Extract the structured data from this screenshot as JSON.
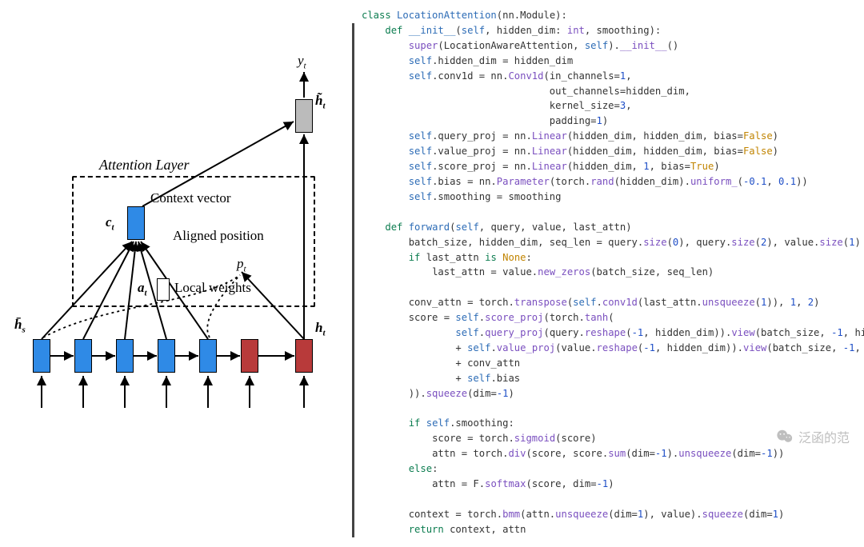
{
  "diagram": {
    "title": "Attention Layer",
    "context_vector_label": "Context vector",
    "aligned_position_label": "Aligned position",
    "local_weights_label": "Local weights",
    "y_t": "y",
    "y_t_sub": "t",
    "h_tilde": "h̃",
    "h_tilde_sub": "t",
    "c_t": "c",
    "c_t_sub": "t",
    "a_t": "a",
    "a_t_sub": "t",
    "p_t": "p",
    "p_t_sub": "t",
    "h_bar_s": "h̄",
    "h_bar_s_sub": "s",
    "h_t": "h",
    "h_t_sub": "t",
    "num_blue_blocks": 5,
    "num_red_blocks": 2
  },
  "code": {
    "indent": "    ",
    "lines": [
      {
        "kind": "nogutter",
        "tokens": [
          [
            "kw",
            "class "
          ],
          [
            "nm",
            "LocationAttention"
          ],
          [
            "",
            "(nn.Module):"
          ]
        ]
      },
      {
        "indent": 1,
        "tokens": [
          [
            "kw",
            "def "
          ],
          [
            "nm",
            "__init__"
          ],
          [
            "",
            "("
          ],
          [
            "slf",
            "self"
          ],
          [
            "",
            ", hidden_dim: "
          ],
          [
            "ty",
            "int"
          ],
          [
            "",
            ", smoothing):"
          ]
        ]
      },
      {
        "indent": 2,
        "tokens": [
          [
            "fn",
            "super"
          ],
          [
            "",
            "(LocationAwareAttention, "
          ],
          [
            "slf",
            "self"
          ],
          [
            "",
            ")."
          ],
          [
            "fn",
            "__init__"
          ],
          [
            "",
            "()"
          ]
        ]
      },
      {
        "indent": 2,
        "tokens": [
          [
            "slf",
            "self"
          ],
          [
            "",
            ".hidden_dim = hidden_dim"
          ]
        ]
      },
      {
        "indent": 2,
        "tokens": [
          [
            "slf",
            "self"
          ],
          [
            "",
            ".conv1d = nn."
          ],
          [
            "fn",
            "Conv1d"
          ],
          [
            "",
            "(in_channels="
          ],
          [
            "num",
            "1"
          ],
          [
            "",
            ","
          ]
        ]
      },
      {
        "indent": 2,
        "tokens": [
          [
            "",
            "                        out_channels=hidden_dim,"
          ]
        ]
      },
      {
        "indent": 2,
        "tokens": [
          [
            "",
            "                        kernel_size="
          ],
          [
            "num",
            "3"
          ],
          [
            "",
            ","
          ]
        ]
      },
      {
        "indent": 2,
        "tokens": [
          [
            "",
            "                        padding="
          ],
          [
            "num",
            "1"
          ],
          [
            "",
            ")"
          ]
        ]
      },
      {
        "indent": 2,
        "tokens": [
          [
            "slf",
            "self"
          ],
          [
            "",
            ".query_proj = nn."
          ],
          [
            "fn",
            "Linear"
          ],
          [
            "",
            "(hidden_dim, hidden_dim, bias="
          ],
          [
            "bval",
            "False"
          ],
          [
            "",
            ")"
          ]
        ]
      },
      {
        "indent": 2,
        "tokens": [
          [
            "slf",
            "self"
          ],
          [
            "",
            ".value_proj = nn."
          ],
          [
            "fn",
            "Linear"
          ],
          [
            "",
            "(hidden_dim, hidden_dim, bias="
          ],
          [
            "bval",
            "False"
          ],
          [
            "",
            ")"
          ]
        ]
      },
      {
        "indent": 2,
        "tokens": [
          [
            "slf",
            "self"
          ],
          [
            "",
            ".score_proj = nn."
          ],
          [
            "fn",
            "Linear"
          ],
          [
            "",
            "(hidden_dim, "
          ],
          [
            "num",
            "1"
          ],
          [
            "",
            ", bias="
          ],
          [
            "bval",
            "True"
          ],
          [
            "",
            ")"
          ]
        ]
      },
      {
        "indent": 2,
        "tokens": [
          [
            "slf",
            "self"
          ],
          [
            "",
            ".bias = nn."
          ],
          [
            "fn",
            "Parameter"
          ],
          [
            "",
            "(torch."
          ],
          [
            "fn",
            "rand"
          ],
          [
            "",
            "(hidden_dim)."
          ],
          [
            "fn",
            "uniform_"
          ],
          [
            "",
            "("
          ],
          [
            "num",
            "-0.1"
          ],
          [
            "",
            ", "
          ],
          [
            "num",
            "0.1"
          ],
          [
            "",
            "))"
          ]
        ]
      },
      {
        "indent": 2,
        "tokens": [
          [
            "slf",
            "self"
          ],
          [
            "",
            ".smoothing = smoothing"
          ]
        ]
      },
      {
        "kind": "blank"
      },
      {
        "indent": 1,
        "tokens": [
          [
            "kw",
            "def "
          ],
          [
            "nm",
            "forward"
          ],
          [
            "",
            "("
          ],
          [
            "slf",
            "self"
          ],
          [
            "",
            ", query, value, last_attn)"
          ]
        ]
      },
      {
        "indent": 2,
        "tokens": [
          [
            "",
            "batch_size, hidden_dim, seq_len = query."
          ],
          [
            "fn",
            "size"
          ],
          [
            "",
            "("
          ],
          [
            "num",
            "0"
          ],
          [
            "",
            "), query."
          ],
          [
            "fn",
            "size"
          ],
          [
            "",
            "("
          ],
          [
            "num",
            "2"
          ],
          [
            "",
            "), value."
          ],
          [
            "fn",
            "size"
          ],
          [
            "",
            "("
          ],
          [
            "num",
            "1"
          ],
          [
            "",
            ")"
          ]
        ]
      },
      {
        "indent": 2,
        "tokens": [
          [
            "kw",
            "if"
          ],
          [
            "",
            " last_attn "
          ],
          [
            "kw",
            "is"
          ],
          [
            "",
            " "
          ],
          [
            "nnm",
            "None"
          ],
          [
            "",
            ":"
          ]
        ]
      },
      {
        "indent": 3,
        "tokens": [
          [
            "",
            "last_attn = value."
          ],
          [
            "fn",
            "new_zeros"
          ],
          [
            "",
            "(batch_size, seq_len)"
          ]
        ]
      },
      {
        "kind": "blank"
      },
      {
        "indent": 2,
        "tokens": [
          [
            "",
            "conv_attn = torch."
          ],
          [
            "fn",
            "transpose"
          ],
          [
            "",
            "("
          ],
          [
            "slf",
            "self"
          ],
          [
            "",
            "."
          ],
          [
            "fn",
            "conv1d"
          ],
          [
            "",
            "(last_attn."
          ],
          [
            "fn",
            "unsqueeze"
          ],
          [
            "",
            "("
          ],
          [
            "num",
            "1"
          ],
          [
            "",
            ")), "
          ],
          [
            "num",
            "1"
          ],
          [
            "",
            ", "
          ],
          [
            "num",
            "2"
          ],
          [
            "",
            ")"
          ]
        ]
      },
      {
        "indent": 2,
        "tokens": [
          [
            "",
            "score = "
          ],
          [
            "slf",
            "self"
          ],
          [
            "",
            "."
          ],
          [
            "fn",
            "score_proj"
          ],
          [
            "",
            "(torch."
          ],
          [
            "fn",
            "tanh"
          ],
          [
            "",
            "("
          ]
        ]
      },
      {
        "indent": 4,
        "tokens": [
          [
            "slf",
            "self"
          ],
          [
            "",
            "."
          ],
          [
            "fn",
            "query_proj"
          ],
          [
            "",
            "(query."
          ],
          [
            "fn",
            "reshape"
          ],
          [
            "",
            "("
          ],
          [
            "num",
            "-1"
          ],
          [
            "",
            ", hidden_dim))."
          ],
          [
            "fn",
            "view"
          ],
          [
            "",
            "(batch_size, "
          ],
          [
            "num",
            "-1"
          ],
          [
            "",
            ", hidden_dim)"
          ]
        ]
      },
      {
        "indent": 4,
        "tokens": [
          [
            "",
            "+ "
          ],
          [
            "slf",
            "self"
          ],
          [
            "",
            "."
          ],
          [
            "fn",
            "value_proj"
          ],
          [
            "",
            "(value."
          ],
          [
            "fn",
            "reshape"
          ],
          [
            "",
            "("
          ],
          [
            "num",
            "-1"
          ],
          [
            "",
            ", hidden_dim))."
          ],
          [
            "fn",
            "view"
          ],
          [
            "",
            "(batch_size, "
          ],
          [
            "num",
            "-1"
          ],
          [
            "",
            ", hidden_dim)"
          ]
        ]
      },
      {
        "indent": 4,
        "tokens": [
          [
            "",
            "+ conv_attn"
          ]
        ]
      },
      {
        "indent": 4,
        "tokens": [
          [
            "",
            "+ "
          ],
          [
            "slf",
            "self"
          ],
          [
            "",
            ".bias"
          ]
        ]
      },
      {
        "indent": 2,
        "tokens": [
          [
            "",
            "))."
          ],
          [
            "fn",
            "squeeze"
          ],
          [
            "",
            "(dim="
          ],
          [
            "num",
            "-1"
          ],
          [
            "",
            ")"
          ]
        ]
      },
      {
        "kind": "blank"
      },
      {
        "indent": 2,
        "tokens": [
          [
            "kw",
            "if"
          ],
          [
            "",
            " "
          ],
          [
            "slf",
            "self"
          ],
          [
            "",
            ".smoothing:"
          ]
        ]
      },
      {
        "indent": 3,
        "tokens": [
          [
            "",
            "score = torch."
          ],
          [
            "fn",
            "sigmoid"
          ],
          [
            "",
            "(score)"
          ]
        ]
      },
      {
        "indent": 3,
        "tokens": [
          [
            "",
            "attn = torch."
          ],
          [
            "fn",
            "div"
          ],
          [
            "",
            "(score, score."
          ],
          [
            "fn",
            "sum"
          ],
          [
            "",
            "(dim="
          ],
          [
            "num",
            "-1"
          ],
          [
            "",
            ")."
          ],
          [
            "fn",
            "unsqueeze"
          ],
          [
            "",
            "(dim="
          ],
          [
            "num",
            "-1"
          ],
          [
            "",
            "))"
          ]
        ]
      },
      {
        "indent": 2,
        "tokens": [
          [
            "kw",
            "else"
          ],
          [
            "",
            ":"
          ]
        ]
      },
      {
        "indent": 3,
        "tokens": [
          [
            "",
            "attn = F."
          ],
          [
            "fn",
            "softmax"
          ],
          [
            "",
            "(score, dim="
          ],
          [
            "num",
            "-1"
          ],
          [
            "",
            ")"
          ]
        ]
      },
      {
        "kind": "blank"
      },
      {
        "indent": 2,
        "tokens": [
          [
            "",
            "context = torch."
          ],
          [
            "fn",
            "bmm"
          ],
          [
            "",
            "(attn."
          ],
          [
            "fn",
            "unsqueeze"
          ],
          [
            "",
            "(dim="
          ],
          [
            "num",
            "1"
          ],
          [
            "",
            "), value)."
          ],
          [
            "fn",
            "squeeze"
          ],
          [
            "",
            "(dim="
          ],
          [
            "num",
            "1"
          ],
          [
            "",
            ")"
          ]
        ]
      },
      {
        "indent": 2,
        "tokens": [
          [
            "kw",
            "return"
          ],
          [
            "",
            " context, attn"
          ]
        ]
      }
    ]
  },
  "watermark": {
    "text": "泛函的范",
    "icon": "wechat"
  }
}
